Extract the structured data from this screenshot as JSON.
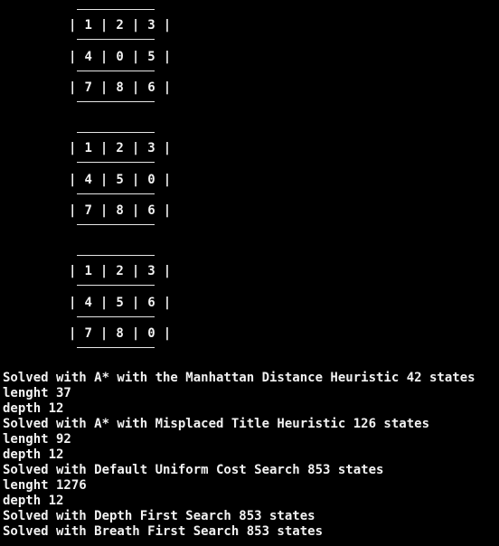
{
  "boards": [
    {
      "rows": [
        "| 1 | 2 | 3 |",
        "| 4 | 0 | 5 |",
        "| 7 | 8 | 6 |"
      ]
    },
    {
      "rows": [
        "| 1 | 2 | 3 |",
        "| 4 | 5 | 0 |",
        "| 7 | 8 | 6 |"
      ]
    },
    {
      "rows": [
        "| 1 | 2 | 3 |",
        "| 4 | 5 | 6 |",
        "| 7 | 8 | 0 |"
      ]
    }
  ],
  "log_lines": [
    "Solved with A* with the Manhattan Distance Heuristic 42 states",
    "lenght 37",
    "depth 12",
    "Solved with A* with Misplaced Title Heuristic 126 states",
    "lenght 92",
    "depth 12",
    "Solved with Default Uniform Cost Search 853 states",
    "lenght 1276",
    "depth 12",
    "Solved with Depth First Search 853 states",
    "Solved with Breath First Search 853 states"
  ],
  "colors": {
    "background": "#000000",
    "text": "#f2f2f2"
  }
}
